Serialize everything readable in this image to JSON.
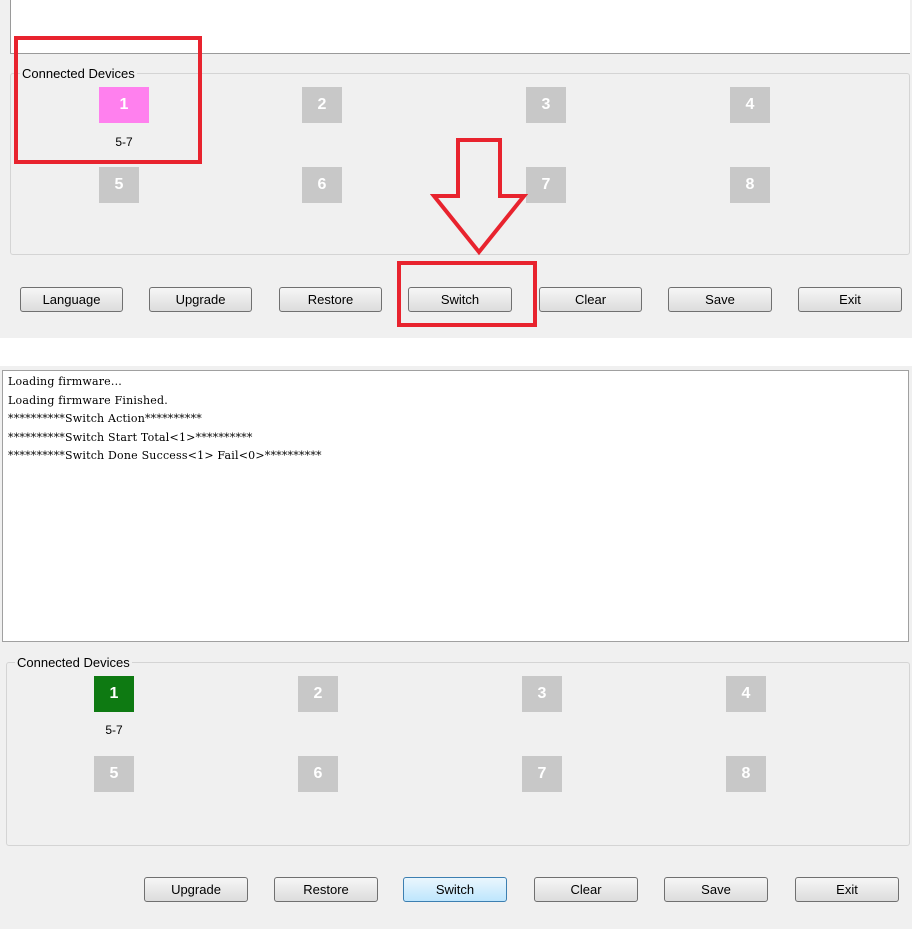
{
  "colors": {
    "device_pink": "#ff80ee",
    "device_green": "#0e7a12",
    "device_gray": "#c8c8c8",
    "highlight_red": "#e8232e"
  },
  "top_panel": {
    "group_label": "Connected Devices",
    "devices": [
      "1",
      "2",
      "3",
      "4",
      "5",
      "6",
      "7",
      "8"
    ],
    "device1_port": "5-7",
    "buttons": {
      "language": "Language",
      "upgrade": "Upgrade",
      "restore": "Restore",
      "switch": "Switch",
      "clear": "Clear",
      "save": "Save",
      "exit": "Exit"
    }
  },
  "bottom_panel": {
    "log_lines": [
      "Loading firmware...",
      "Loading firmware Finished.",
      "**********Switch Action**********",
      "**********Switch Start Total<1>**********",
      "**********Switch Done Success<1> Fail<0>**********"
    ],
    "group_label": "Connected Devices",
    "devices": [
      "1",
      "2",
      "3",
      "4",
      "5",
      "6",
      "7",
      "8"
    ],
    "device1_port": "5-7",
    "buttons": {
      "upgrade": "Upgrade",
      "restore": "Restore",
      "switch": "Switch",
      "clear": "Clear",
      "save": "Save",
      "exit": "Exit"
    }
  },
  "annotations": {
    "arrow_icon": "down-arrow-icon"
  }
}
